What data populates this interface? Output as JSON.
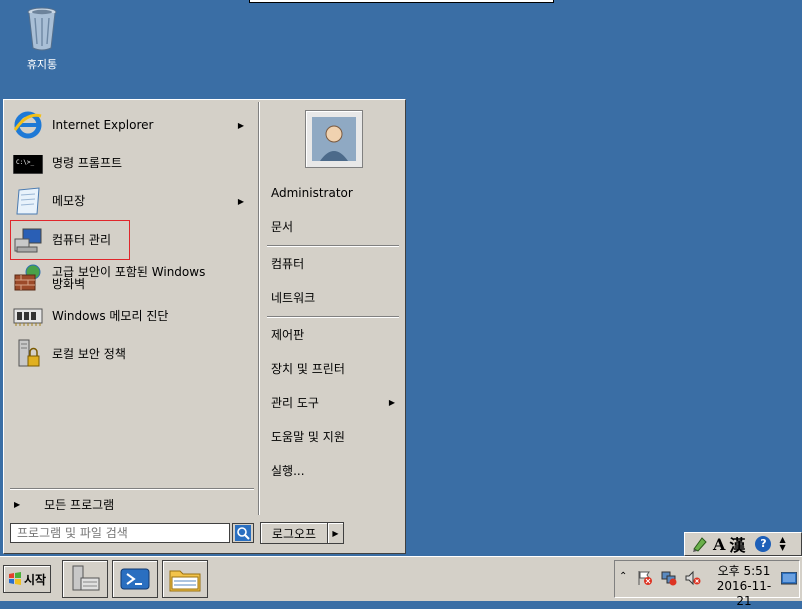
{
  "desktop": {
    "recycle_bin_label": "휴지통"
  },
  "start_menu": {
    "left_items": [
      {
        "label": "Internet Explorer",
        "icon": "internet-explorer-icon",
        "has_submenu": true
      },
      {
        "label": "명령 프롬프트",
        "icon": "command-prompt-icon",
        "has_submenu": false
      },
      {
        "label": "메모장",
        "icon": "notepad-icon",
        "has_submenu": true
      },
      {
        "label": "컴퓨터 관리",
        "icon": "computer-management-icon",
        "has_submenu": false,
        "highlighted": true
      },
      {
        "label_line1": "고급 보안이 포함된 Windows",
        "label_line2": "방화벽",
        "icon": "firewall-icon",
        "has_submenu": false
      },
      {
        "label": "Windows 메모리 진단",
        "icon": "memory-diagnostic-icon",
        "has_submenu": false
      },
      {
        "label": "로컬 보안 정책",
        "icon": "local-security-policy-icon",
        "has_submenu": false
      }
    ],
    "all_programs": "모든 프로그램",
    "search_placeholder": "프로그램 및 파일 검색",
    "user_name": "Administrator",
    "right_items": [
      {
        "label": "Administrator"
      },
      {
        "label": "문서"
      },
      {
        "label": "컴퓨터"
      },
      {
        "label": "네트워크"
      },
      {
        "label": "제어판"
      },
      {
        "label": "장치 및 프린터"
      },
      {
        "label": "관리 도구",
        "has_submenu": true
      },
      {
        "label": "도움말 및 지원"
      },
      {
        "label": "실행..."
      }
    ],
    "logoff_label": "로그오프"
  },
  "language_bar": {
    "mode_label": "A",
    "hanja_label": "漢",
    "help_label": "?"
  },
  "taskbar": {
    "start_label": "시작",
    "clock_time": "오후 5:51",
    "clock_date": "2016-11-21",
    "tray_expand": "⌃"
  },
  "colors": {
    "desktop": "#3a6ea5",
    "menu_bg": "#d4d0c8",
    "highlight_border": "#e0262b"
  }
}
